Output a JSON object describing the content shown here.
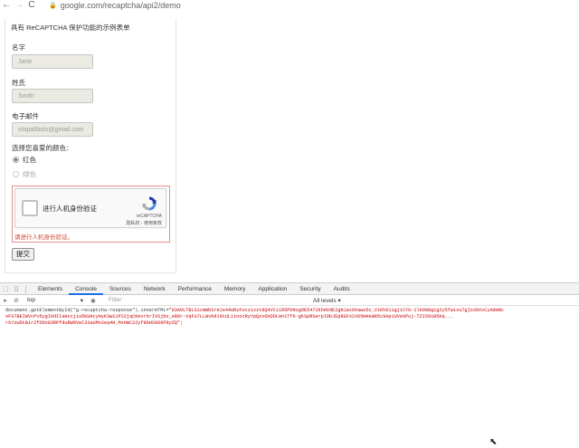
{
  "browser": {
    "url": "google.com/recaptcha/api2/demo",
    "back": "←",
    "forward": "→",
    "reload": "C"
  },
  "form": {
    "title": "具有 ReCAPTCHA 保护功能的示例表单",
    "first_name_label": "名字",
    "first_name_value": "Jane",
    "last_name_label": "姓氏",
    "last_name_value": "Smith",
    "email_label": "电子邮件",
    "email_value": "stopallbots@gmail.com",
    "color_label": "选择您喜爱的颜色：",
    "color_options": [
      "红色",
      "绿色"
    ],
    "selected_color": "红色",
    "submit_label": "提交"
  },
  "recaptcha": {
    "checkbox_label": "进行人机身份验证",
    "brand": "reCAPTCHA",
    "links": "隐私权 - 使用条款",
    "error": "请进行人机身份验证。"
  },
  "devtools": {
    "tabs": [
      "Elements",
      "Console",
      "Sources",
      "Network",
      "Performance",
      "Memory",
      "Application",
      "Security",
      "Audits"
    ],
    "active_tab": "Console",
    "context": "top",
    "filter_placeholder": "Filter",
    "levels": "All levels ▾",
    "command_prefix": "document.getElementById(\"g-recaptcha-response\").innerHTML=",
    "command_lines": [
      "\"03AOLTBLS1cmWbSrHJe44URzFocz1zzt8Q4VC11R5PbNxgOE5472khHVdE2gNJax9Vawu5c_V1Kh611gj1CYG-1lK9N8g1g2y5fw1vu7g]o39XvCyAdmNc",
      "sFX7BEIWVcPv5ygI0dIIaHxcj1u5KUHcyHyK3wS1P22jqCKevrkrIVSjbx_sR8r-VqFs7LLWvb819tUL1tnocRyYpQxvOADOLHn1Tf0-gkSpRSerpI0bJEp8GFo2xD5mHeW85c9ApiUVeXPuj-TZ1591B5Kq...",
      "rkYzwDtBir2fOOo83RPfduRW9Vwl33aUMxXeq4H_MxHmC22yf8bHS066P8yZQ\";"
    ]
  }
}
